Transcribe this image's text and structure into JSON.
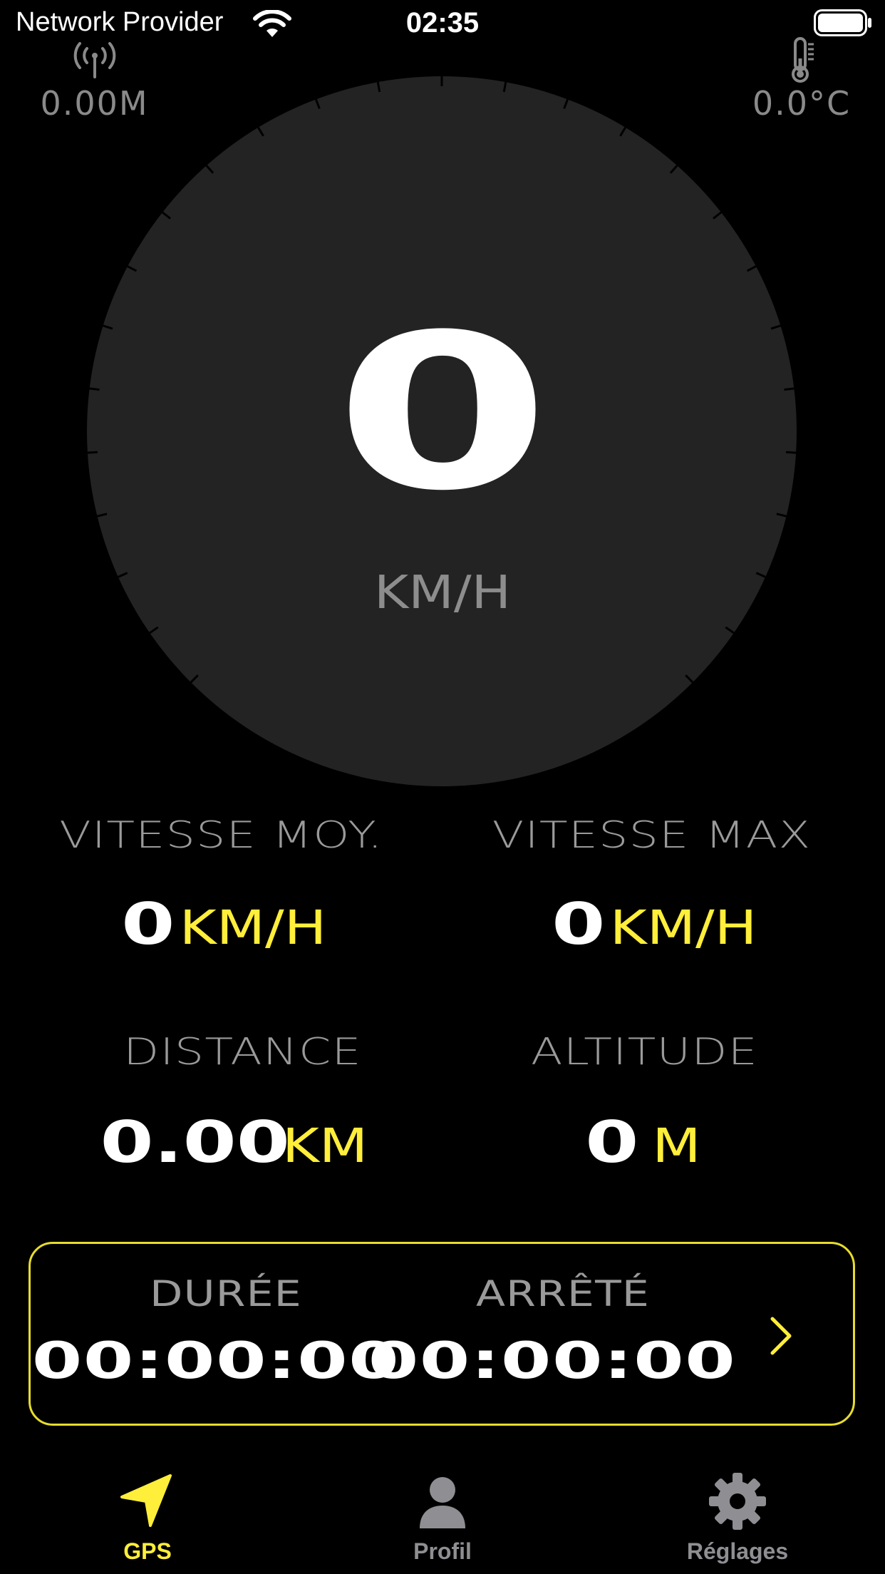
{
  "status_bar": {
    "carrier": "Network Provider",
    "time": "02:35"
  },
  "top": {
    "gps_accuracy": "0.00M",
    "temperature": "0.0°C"
  },
  "speedometer": {
    "speed": "0",
    "unit": "KM/H"
  },
  "stats": {
    "avg_speed": {
      "label": "VITESSE MOY.",
      "value": "0",
      "unit": "KM/H"
    },
    "max_speed": {
      "label": "VITESSE MAX",
      "value": "0",
      "unit": "KM/H"
    },
    "distance": {
      "label": "DISTANCE",
      "value": "0.00",
      "unit": "KM"
    },
    "altitude": {
      "label": "ALTITUDE",
      "value": "0",
      "unit": "M"
    }
  },
  "timers": {
    "duration": {
      "label": "DURÉE",
      "value": "00:00:00"
    },
    "stopped": {
      "label": "ARRÊTÉ",
      "value": "00:00:00"
    }
  },
  "tabs": [
    {
      "label": "GPS",
      "icon": "navigation-arrow-icon",
      "active": true
    },
    {
      "label": "Profil",
      "icon": "person-icon",
      "active": false
    },
    {
      "label": "Réglages",
      "icon": "gear-icon",
      "active": false
    }
  ],
  "colors": {
    "accent": "#ffee3a",
    "dial": "#232323",
    "inactive": "#8e8e93",
    "background": "#000000"
  }
}
